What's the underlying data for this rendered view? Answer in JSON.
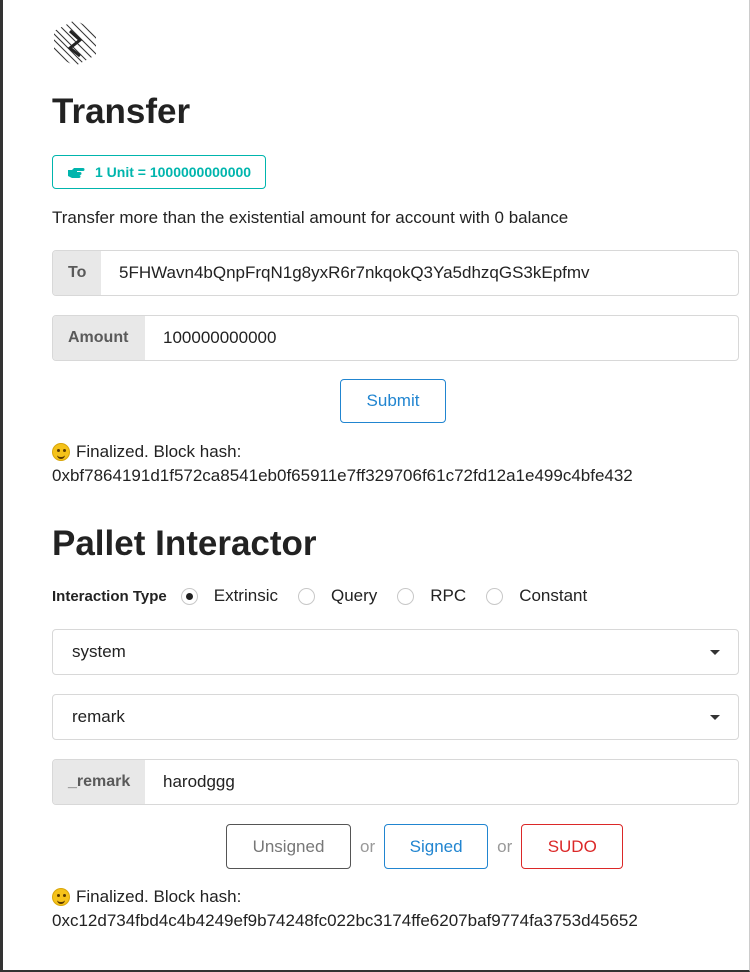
{
  "transfer": {
    "title": "Transfer",
    "unit_label": "1 Unit = 1000000000000",
    "hint": "Transfer more than the existential amount for account with 0 balance",
    "to": {
      "label": "To",
      "value": "5FHWavn4bQnpFrqN1g8yxR6r7nkqokQ3Ya5dhzqGS3kEpfmv"
    },
    "amount": {
      "label": "Amount",
      "value": "100000000000"
    },
    "submit_label": "Submit",
    "status": {
      "line1": "Finalized. Block hash:",
      "hash": "0xbf7864191d1f572ca8541eb0f65911e7ff329706f61c72fd12a1e499c4bfe432"
    }
  },
  "pallet": {
    "title": "Pallet Interactor",
    "interaction_type_label": "Interaction Type",
    "interaction_types": [
      {
        "label": "Extrinsic",
        "selected": true
      },
      {
        "label": "Query",
        "selected": false
      },
      {
        "label": "RPC",
        "selected": false
      },
      {
        "label": "Constant",
        "selected": false
      }
    ],
    "pallet_select": "system",
    "callable_select": "remark",
    "param": {
      "label": "_remark",
      "value": "harodggg"
    },
    "buttons": {
      "unsigned": "Unsigned",
      "or": "or",
      "signed": "Signed",
      "sudo": "SUDO"
    },
    "status": {
      "line1": "Finalized. Block hash:",
      "hash": "0xc12d734fbd4c4b4249ef9b74248fc022bc3174ffe6207baf9774fa3753d45652"
    }
  },
  "colors": {
    "teal": "#00b5ad",
    "blue": "#2185d0",
    "red": "#db2828"
  }
}
